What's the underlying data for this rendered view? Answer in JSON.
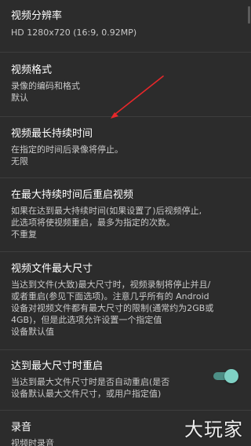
{
  "settings": [
    {
      "title": "视频分辨率",
      "value": "HD 1280x720 (16:9, 0.92MP)"
    },
    {
      "title": "视频格式",
      "summary": "录像的编码和格式",
      "value": "默认"
    },
    {
      "title": "视频最长持续时间",
      "summary": "在指定的时间后录像将停止。",
      "value": "无限"
    },
    {
      "title": "在最大持续时间后重启视频",
      "summary": "如果在达到最大持续时间(如果设置了)后视频停止,\n此选项将使视频重启，最多为指定的次数。",
      "value": "不重复"
    },
    {
      "title": "视频文件最大尺寸",
      "summary": "当达到文件(大致)最大尺寸时，视频录制将停止并且/\n或者重启(参见下面选项)。注意几乎所有的 Android\n设备对视频文件都有最大尺寸的限制(通常约为2GB或\n4GB)，但是此选项允许设置一个指定值",
      "value": "设备默认值"
    },
    {
      "title": "达到最大尺寸时重启",
      "summary": "当达到最大文件尺寸时是否自动重启(是否\n设备默认最大文件尺寸，或用户指定值)",
      "switch_on": true
    },
    {
      "title": "录音",
      "summary": "视频时录音"
    }
  ],
  "watermark": "大玩家",
  "colors": {
    "background": "#2c2c2c",
    "divider": "#3d3d3d",
    "switch_track": "#4d8f86",
    "switch_thumb": "#7fd1c4",
    "arrow": "#e8272a"
  }
}
